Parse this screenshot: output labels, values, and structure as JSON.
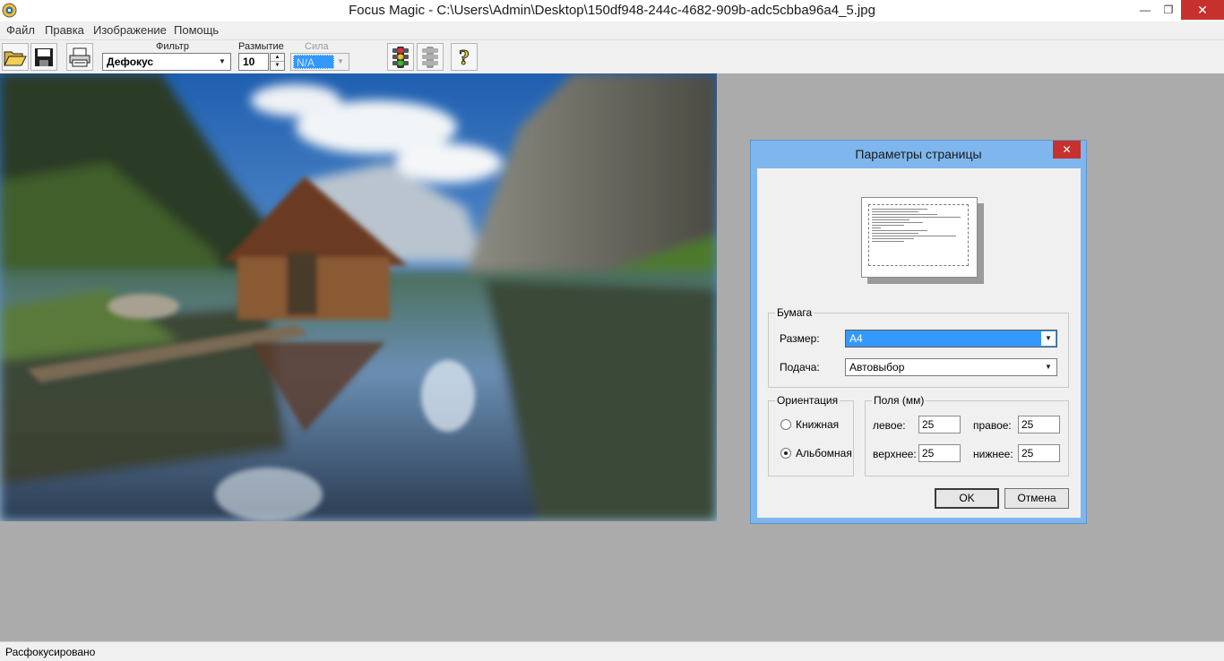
{
  "window": {
    "title": "Focus Magic - C:\\Users\\Admin\\Desktop\\150df948-244c-4682-909b-adc5cbba96a4_5.jpg",
    "minimize_glyph": "—",
    "maximize_glyph": "❐",
    "close_glyph": "✕"
  },
  "menu": {
    "items": [
      {
        "label": "Файл"
      },
      {
        "label": "Правка"
      },
      {
        "label": "Изображение"
      },
      {
        "label": "Помощь"
      }
    ]
  },
  "toolbar": {
    "icons": [
      "open-folder-icon",
      "save-disk-icon",
      "printer-icon",
      "traffic-light-go-icon",
      "traffic-light-disabled-icon",
      "help-question-icon"
    ],
    "filter_label": "Фильтр",
    "filter_value": "Дефокус",
    "blur_label": "Размытие",
    "blur_value": "10",
    "strength_label": "Сила",
    "strength_value": "N/A"
  },
  "status": {
    "text": "Расфокусировано"
  },
  "dialog": {
    "title": "Параметры страницы",
    "close_glyph": "✕",
    "paper": {
      "legend": "Бумага",
      "size_label": "Размер:",
      "size_value": "A4",
      "source_label": "Подача:",
      "source_value": "Автовыбор"
    },
    "orientation": {
      "legend": "Ориентация",
      "portrait_label": "Книжная",
      "landscape_label": "Альбомная",
      "selected": "landscape"
    },
    "margins": {
      "legend": "Поля (мм)",
      "left_label": "левое:",
      "left_value": "25",
      "right_label": "правое:",
      "right_value": "25",
      "top_label": "верхнее:",
      "top_value": "25",
      "bottom_label": "нижнее:",
      "bottom_value": "25"
    },
    "ok_label": "OK",
    "cancel_label": "Отмена"
  },
  "colors": {
    "dialog_frame": "#7fb6ed",
    "close_red": "#c7312d",
    "selection_blue": "#3399ff",
    "workspace_gray": "#ababab"
  }
}
